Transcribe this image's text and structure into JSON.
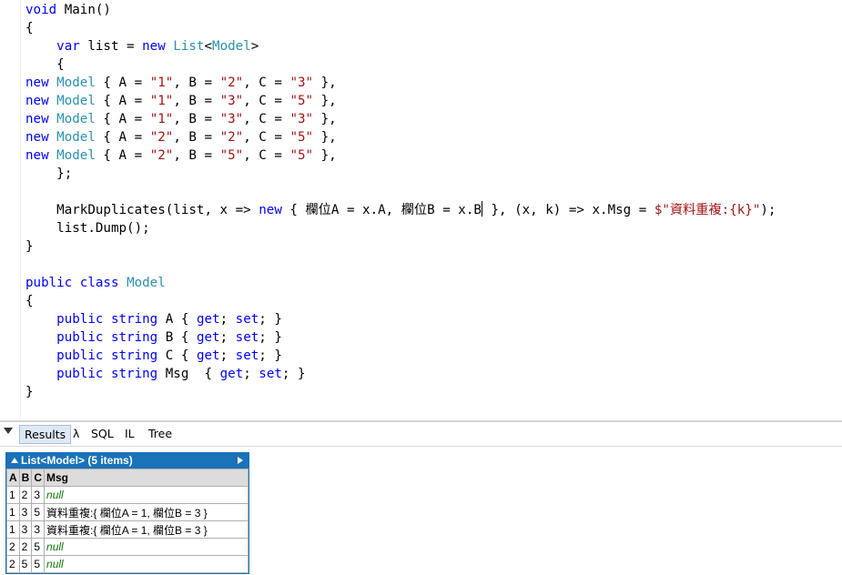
{
  "code": {
    "lines": [
      [
        {
          "t": "void",
          "c": "kw"
        },
        {
          "t": " Main()"
        }
      ],
      [
        {
          "t": "{"
        }
      ],
      [
        {
          "t": "    "
        },
        {
          "t": "var",
          "c": "kw"
        },
        {
          "t": " list = "
        },
        {
          "t": "new",
          "c": "kw"
        },
        {
          "t": " "
        },
        {
          "t": "List",
          "c": "ty"
        },
        {
          "t": "<"
        },
        {
          "t": "Model",
          "c": "ty"
        },
        {
          "t": ">"
        }
      ],
      [
        {
          "t": "    {"
        }
      ],
      [
        {
          "t": "new",
          "c": "kw"
        },
        {
          "t": " "
        },
        {
          "t": "Model",
          "c": "ty"
        },
        {
          "t": " { A = "
        },
        {
          "t": "\"1\"",
          "c": "str"
        },
        {
          "t": ", B = "
        },
        {
          "t": "\"2\"",
          "c": "str"
        },
        {
          "t": ", C = "
        },
        {
          "t": "\"3\"",
          "c": "str"
        },
        {
          "t": " },"
        }
      ],
      [
        {
          "t": "new",
          "c": "kw"
        },
        {
          "t": " "
        },
        {
          "t": "Model",
          "c": "ty"
        },
        {
          "t": " { A = "
        },
        {
          "t": "\"1\"",
          "c": "str"
        },
        {
          "t": ", B = "
        },
        {
          "t": "\"3\"",
          "c": "str"
        },
        {
          "t": ", C = "
        },
        {
          "t": "\"5\"",
          "c": "str"
        },
        {
          "t": " },"
        }
      ],
      [
        {
          "t": "new",
          "c": "kw"
        },
        {
          "t": " "
        },
        {
          "t": "Model",
          "c": "ty"
        },
        {
          "t": " { A = "
        },
        {
          "t": "\"1\"",
          "c": "str"
        },
        {
          "t": ", B = "
        },
        {
          "t": "\"3\"",
          "c": "str"
        },
        {
          "t": ", C = "
        },
        {
          "t": "\"3\"",
          "c": "str"
        },
        {
          "t": " },"
        }
      ],
      [
        {
          "t": "new",
          "c": "kw"
        },
        {
          "t": " "
        },
        {
          "t": "Model",
          "c": "ty"
        },
        {
          "t": " { A = "
        },
        {
          "t": "\"2\"",
          "c": "str"
        },
        {
          "t": ", B = "
        },
        {
          "t": "\"2\"",
          "c": "str"
        },
        {
          "t": ", C = "
        },
        {
          "t": "\"5\"",
          "c": "str"
        },
        {
          "t": " },"
        }
      ],
      [
        {
          "t": "new",
          "c": "kw"
        },
        {
          "t": " "
        },
        {
          "t": "Model",
          "c": "ty"
        },
        {
          "t": " { A = "
        },
        {
          "t": "\"2\"",
          "c": "str"
        },
        {
          "t": ", B = "
        },
        {
          "t": "\"5\"",
          "c": "str"
        },
        {
          "t": ", C = "
        },
        {
          "t": "\"5\"",
          "c": "str"
        },
        {
          "t": " },"
        }
      ],
      [
        {
          "t": "    };"
        }
      ],
      [
        {
          "t": ""
        }
      ],
      [
        {
          "t": "    MarkDuplicates(list, x => "
        },
        {
          "t": "new",
          "c": "kw"
        },
        {
          "t": " { 欄位A = x.A, 欄位B = x.B"
        },
        {
          "caret": true
        },
        {
          "t": " }, (x, k) => x.Msg = "
        },
        {
          "t": "$\"資料重複:{k}\"",
          "c": "str"
        },
        {
          "t": ");"
        }
      ],
      [
        {
          "t": "    list.Dump();"
        }
      ],
      [
        {
          "t": "}"
        }
      ],
      [
        {
          "t": ""
        }
      ],
      [
        {
          "t": "public",
          "c": "kw"
        },
        {
          "t": " "
        },
        {
          "t": "class",
          "c": "kw"
        },
        {
          "t": " "
        },
        {
          "t": "Model",
          "c": "ty"
        }
      ],
      [
        {
          "t": "{"
        }
      ],
      [
        {
          "t": "    "
        },
        {
          "t": "public",
          "c": "kw"
        },
        {
          "t": " "
        },
        {
          "t": "string",
          "c": "kw"
        },
        {
          "t": " A { "
        },
        {
          "t": "get",
          "c": "kw"
        },
        {
          "t": "; "
        },
        {
          "t": "set",
          "c": "kw"
        },
        {
          "t": "; }"
        }
      ],
      [
        {
          "t": "    "
        },
        {
          "t": "public",
          "c": "kw"
        },
        {
          "t": " "
        },
        {
          "t": "string",
          "c": "kw"
        },
        {
          "t": " B { "
        },
        {
          "t": "get",
          "c": "kw"
        },
        {
          "t": "; "
        },
        {
          "t": "set",
          "c": "kw"
        },
        {
          "t": "; }"
        }
      ],
      [
        {
          "t": "    "
        },
        {
          "t": "public",
          "c": "kw"
        },
        {
          "t": " "
        },
        {
          "t": "string",
          "c": "kw"
        },
        {
          "t": " C { "
        },
        {
          "t": "get",
          "c": "kw"
        },
        {
          "t": "; "
        },
        {
          "t": "set",
          "c": "kw"
        },
        {
          "t": "; }"
        }
      ],
      [
        {
          "t": "    "
        },
        {
          "t": "public",
          "c": "kw"
        },
        {
          "t": " "
        },
        {
          "t": "string",
          "c": "kw"
        },
        {
          "t": " Msg  { "
        },
        {
          "t": "get",
          "c": "kw"
        },
        {
          "t": "; "
        },
        {
          "t": "set",
          "c": "kw"
        },
        {
          "t": "; }"
        }
      ],
      [
        {
          "t": "}"
        }
      ]
    ]
  },
  "tabs": {
    "results": "Results",
    "lambda": "λ",
    "sql": "SQL",
    "il": "IL",
    "tree": "Tree"
  },
  "results": {
    "title": "List<Model> (5 items)",
    "columns": [
      "A",
      "B",
      "C",
      "Msg"
    ],
    "rows": [
      {
        "A": "1",
        "B": "2",
        "C": "3",
        "Msg": "null",
        "null": true
      },
      {
        "A": "1",
        "B": "3",
        "C": "5",
        "Msg": "資料重複:{ 欄位A = 1, 欄位B = 3 }",
        "null": false
      },
      {
        "A": "1",
        "B": "3",
        "C": "3",
        "Msg": "資料重複:{ 欄位A = 1, 欄位B = 3 }",
        "null": false
      },
      {
        "A": "2",
        "B": "2",
        "C": "5",
        "Msg": "null",
        "null": true
      },
      {
        "A": "2",
        "B": "5",
        "C": "5",
        "Msg": "null",
        "null": true
      }
    ]
  }
}
